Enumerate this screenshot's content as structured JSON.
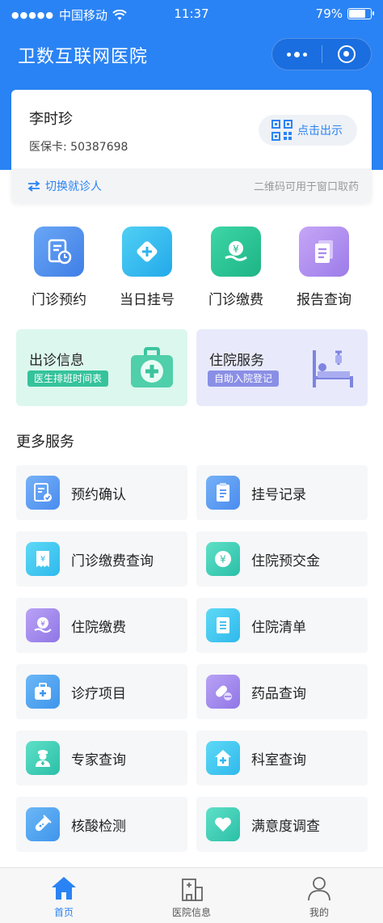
{
  "status_bar": {
    "signal": "●●●●●",
    "carrier": "中国移动",
    "time": "11:37",
    "battery": "79%",
    "battery_level": 0.79
  },
  "nav": {
    "title": "卫数互联网医院"
  },
  "patient": {
    "name": "李时珍",
    "insurance": "医保卡: 50387698",
    "qr_button": "点击出示",
    "switch": "切换就诊人",
    "hint": "二维码可用于窗口取药"
  },
  "quick_actions": [
    {
      "label": "门诊预约",
      "icon": "calendar-clock-icon"
    },
    {
      "label": "当日挂号",
      "icon": "medical-plus-icon"
    },
    {
      "label": "门诊缴费",
      "icon": "yuan-hand-icon"
    },
    {
      "label": "报告查询",
      "icon": "report-document-icon"
    }
  ],
  "banners": [
    {
      "title": "出诊信息",
      "tag": "医生排班时间表",
      "icon": "medical-kit-icon"
    },
    {
      "title": "住院服务",
      "tag": "自助入院登记",
      "icon": "hospital-bed-icon"
    }
  ],
  "more_services": {
    "title": "更多服务",
    "items": [
      {
        "label": "预约确认",
        "icon": "appointment-confirm-icon"
      },
      {
        "label": "挂号记录",
        "icon": "registration-record-icon"
      },
      {
        "label": "门诊缴费查询",
        "icon": "receipt-icon"
      },
      {
        "label": "住院预交金",
        "icon": "yuan-coin-icon"
      },
      {
        "label": "住院缴费",
        "icon": "yuan-hand-icon"
      },
      {
        "label": "住院清单",
        "icon": "list-icon"
      },
      {
        "label": "诊疗项目",
        "icon": "medical-kit-icon"
      },
      {
        "label": "药品查询",
        "icon": "pill-icon"
      },
      {
        "label": "专家查询",
        "icon": "doctor-icon"
      },
      {
        "label": "科室查询",
        "icon": "hospital-house-icon"
      },
      {
        "label": "核酸检测",
        "icon": "test-tube-icon"
      },
      {
        "label": "满意度调查",
        "icon": "heart-icon"
      }
    ]
  },
  "tabbar": [
    {
      "label": "首页",
      "icon": "home-icon",
      "active": true
    },
    {
      "label": "医院信息",
      "icon": "hospital-building-icon",
      "active": false
    },
    {
      "label": "我的",
      "icon": "user-icon",
      "active": false
    }
  ],
  "colors": {
    "primary": "#2a83f4",
    "banner_clinic_bg": "#dcf7ee",
    "banner_clinic_tag": "#35c39c",
    "banner_inpatient_bg": "#e8eafc",
    "banner_inpatient_tag": "#8a8fe6"
  }
}
